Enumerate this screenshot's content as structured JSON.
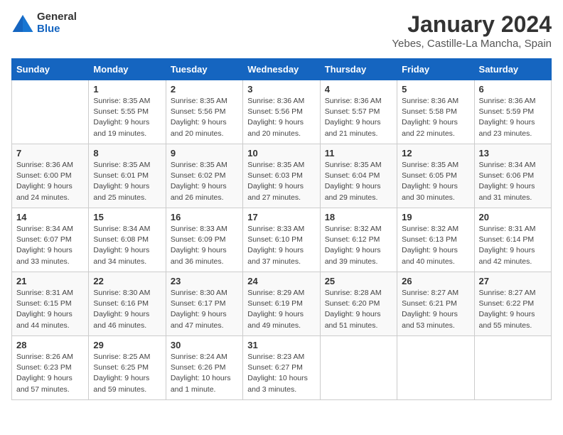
{
  "logo": {
    "general": "General",
    "blue": "Blue"
  },
  "title": "January 2024",
  "subtitle": "Yebes, Castille-La Mancha, Spain",
  "weekdays": [
    "Sunday",
    "Monday",
    "Tuesday",
    "Wednesday",
    "Thursday",
    "Friday",
    "Saturday"
  ],
  "weeks": [
    [
      {
        "day": "",
        "detail": ""
      },
      {
        "day": "1",
        "detail": "Sunrise: 8:35 AM\nSunset: 5:55 PM\nDaylight: 9 hours\nand 19 minutes."
      },
      {
        "day": "2",
        "detail": "Sunrise: 8:35 AM\nSunset: 5:56 PM\nDaylight: 9 hours\nand 20 minutes."
      },
      {
        "day": "3",
        "detail": "Sunrise: 8:36 AM\nSunset: 5:56 PM\nDaylight: 9 hours\nand 20 minutes."
      },
      {
        "day": "4",
        "detail": "Sunrise: 8:36 AM\nSunset: 5:57 PM\nDaylight: 9 hours\nand 21 minutes."
      },
      {
        "day": "5",
        "detail": "Sunrise: 8:36 AM\nSunset: 5:58 PM\nDaylight: 9 hours\nand 22 minutes."
      },
      {
        "day": "6",
        "detail": "Sunrise: 8:36 AM\nSunset: 5:59 PM\nDaylight: 9 hours\nand 23 minutes."
      }
    ],
    [
      {
        "day": "7",
        "detail": "Sunrise: 8:36 AM\nSunset: 6:00 PM\nDaylight: 9 hours\nand 24 minutes."
      },
      {
        "day": "8",
        "detail": "Sunrise: 8:35 AM\nSunset: 6:01 PM\nDaylight: 9 hours\nand 25 minutes."
      },
      {
        "day": "9",
        "detail": "Sunrise: 8:35 AM\nSunset: 6:02 PM\nDaylight: 9 hours\nand 26 minutes."
      },
      {
        "day": "10",
        "detail": "Sunrise: 8:35 AM\nSunset: 6:03 PM\nDaylight: 9 hours\nand 27 minutes."
      },
      {
        "day": "11",
        "detail": "Sunrise: 8:35 AM\nSunset: 6:04 PM\nDaylight: 9 hours\nand 29 minutes."
      },
      {
        "day": "12",
        "detail": "Sunrise: 8:35 AM\nSunset: 6:05 PM\nDaylight: 9 hours\nand 30 minutes."
      },
      {
        "day": "13",
        "detail": "Sunrise: 8:34 AM\nSunset: 6:06 PM\nDaylight: 9 hours\nand 31 minutes."
      }
    ],
    [
      {
        "day": "14",
        "detail": "Sunrise: 8:34 AM\nSunset: 6:07 PM\nDaylight: 9 hours\nand 33 minutes."
      },
      {
        "day": "15",
        "detail": "Sunrise: 8:34 AM\nSunset: 6:08 PM\nDaylight: 9 hours\nand 34 minutes."
      },
      {
        "day": "16",
        "detail": "Sunrise: 8:33 AM\nSunset: 6:09 PM\nDaylight: 9 hours\nand 36 minutes."
      },
      {
        "day": "17",
        "detail": "Sunrise: 8:33 AM\nSunset: 6:10 PM\nDaylight: 9 hours\nand 37 minutes."
      },
      {
        "day": "18",
        "detail": "Sunrise: 8:32 AM\nSunset: 6:12 PM\nDaylight: 9 hours\nand 39 minutes."
      },
      {
        "day": "19",
        "detail": "Sunrise: 8:32 AM\nSunset: 6:13 PM\nDaylight: 9 hours\nand 40 minutes."
      },
      {
        "day": "20",
        "detail": "Sunrise: 8:31 AM\nSunset: 6:14 PM\nDaylight: 9 hours\nand 42 minutes."
      }
    ],
    [
      {
        "day": "21",
        "detail": "Sunrise: 8:31 AM\nSunset: 6:15 PM\nDaylight: 9 hours\nand 44 minutes."
      },
      {
        "day": "22",
        "detail": "Sunrise: 8:30 AM\nSunset: 6:16 PM\nDaylight: 9 hours\nand 46 minutes."
      },
      {
        "day": "23",
        "detail": "Sunrise: 8:30 AM\nSunset: 6:17 PM\nDaylight: 9 hours\nand 47 minutes."
      },
      {
        "day": "24",
        "detail": "Sunrise: 8:29 AM\nSunset: 6:19 PM\nDaylight: 9 hours\nand 49 minutes."
      },
      {
        "day": "25",
        "detail": "Sunrise: 8:28 AM\nSunset: 6:20 PM\nDaylight: 9 hours\nand 51 minutes."
      },
      {
        "day": "26",
        "detail": "Sunrise: 8:27 AM\nSunset: 6:21 PM\nDaylight: 9 hours\nand 53 minutes."
      },
      {
        "day": "27",
        "detail": "Sunrise: 8:27 AM\nSunset: 6:22 PM\nDaylight: 9 hours\nand 55 minutes."
      }
    ],
    [
      {
        "day": "28",
        "detail": "Sunrise: 8:26 AM\nSunset: 6:23 PM\nDaylight: 9 hours\nand 57 minutes."
      },
      {
        "day": "29",
        "detail": "Sunrise: 8:25 AM\nSunset: 6:25 PM\nDaylight: 9 hours\nand 59 minutes."
      },
      {
        "day": "30",
        "detail": "Sunrise: 8:24 AM\nSunset: 6:26 PM\nDaylight: 10 hours\nand 1 minute."
      },
      {
        "day": "31",
        "detail": "Sunrise: 8:23 AM\nSunset: 6:27 PM\nDaylight: 10 hours\nand 3 minutes."
      },
      {
        "day": "",
        "detail": ""
      },
      {
        "day": "",
        "detail": ""
      },
      {
        "day": "",
        "detail": ""
      }
    ]
  ]
}
